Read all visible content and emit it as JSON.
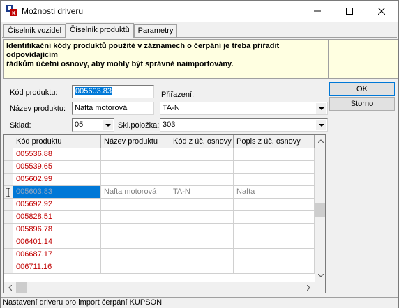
{
  "window": {
    "title": "Možnosti driveru",
    "icon": "app-icon"
  },
  "tabs": [
    {
      "label": "Číselník vozidel",
      "active": false
    },
    {
      "label": "Číselník produktů",
      "active": true
    },
    {
      "label": "Parametry",
      "active": false
    }
  ],
  "info": {
    "line1": "Identifikační kódy produktů použité v záznamech o čerpání je třeba přiřadit odpovídajícím",
    "line2": "řádkům účetní osnovy, aby mohly být správně naimportovány."
  },
  "form": {
    "kod_label": "Kód produktu:",
    "kod_value": "005603.83",
    "nazev_label": "Název produktu:",
    "nazev_value": "Nafta motorová",
    "prirazeni_label": "Přiřazení:",
    "prirazeni_value": "TA-N",
    "sklad_label": "Sklad:",
    "sklad_value": "05",
    "sklpolozka_label": "Skl.položka:",
    "sklpolozka_value": "303"
  },
  "buttons": {
    "ok": "OK",
    "storno": "Storno"
  },
  "grid": {
    "columns": [
      "Kód produktu",
      "Název produktu",
      "Kód z úč. osnovy",
      "Popis z úč. osnovy"
    ],
    "rows": [
      [
        "005536.88",
        "",
        "",
        ""
      ],
      [
        "005539.65",
        "",
        "",
        ""
      ],
      [
        "005602.99",
        "",
        "",
        ""
      ],
      [
        "005603.83",
        "Nafta motorová",
        "TA-N",
        "Nafta"
      ],
      [
        "005692.92",
        "",
        "",
        ""
      ],
      [
        "005828.51",
        "",
        "",
        ""
      ],
      [
        "005896.78",
        "",
        "",
        ""
      ],
      [
        "006401.14",
        "",
        "",
        ""
      ],
      [
        "006687.17",
        "",
        "",
        ""
      ],
      [
        "006711.16",
        "",
        "",
        ""
      ]
    ],
    "current_row": 3
  },
  "status": {
    "text": "Nastavení driveru pro import čerpání KUPSON"
  },
  "colors": {
    "accent": "#0078d7",
    "code_text": "#c00000",
    "info_bg": "#ffffe1"
  }
}
